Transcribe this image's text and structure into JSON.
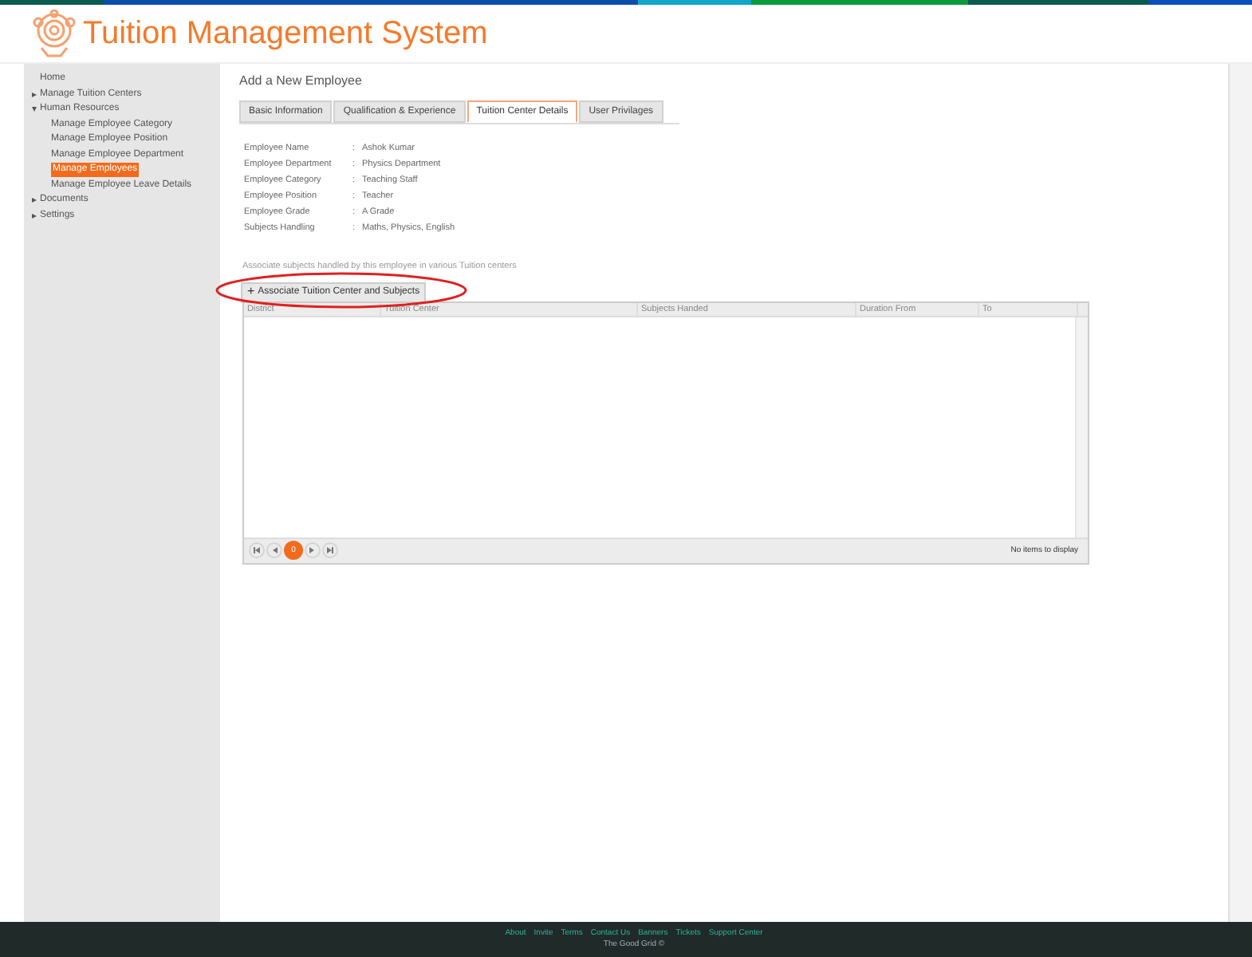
{
  "app_title": "Tuition Management System",
  "sidebar": {
    "items": [
      {
        "label": "Home",
        "selected": false
      },
      {
        "label": "Manage Tuition Centers",
        "expanded": false,
        "selected": false
      },
      {
        "label": "Human Resources",
        "expanded": true,
        "selected": false,
        "children": [
          {
            "label": "Manage Employee Category",
            "selected": false
          },
          {
            "label": "Manage Employee Position",
            "selected": false
          },
          {
            "label": "Manage Employee Department",
            "selected": false
          },
          {
            "label": "Manage Employees",
            "selected": true
          },
          {
            "label": "Manage Employee Leave Details",
            "selected": false
          }
        ]
      },
      {
        "label": "Documents",
        "expanded": false,
        "selected": false
      },
      {
        "label": "Settings",
        "expanded": false,
        "selected": false
      }
    ]
  },
  "page_title": "Add a New Employee",
  "tabs": [
    {
      "label": "Basic Information",
      "selected": false
    },
    {
      "label": "Qualification & Experience",
      "selected": false
    },
    {
      "label": "Tuition Center Details",
      "selected": true
    },
    {
      "label": "User Privilages",
      "selected": false
    }
  ],
  "details": [
    {
      "label": "Employee Name",
      "value": "Ashok Kumar"
    },
    {
      "label": "Employee Department",
      "value": "Physics Department"
    },
    {
      "label": "Employee Category",
      "value": "Teaching Staff"
    },
    {
      "label": "Employee Position",
      "value": "Teacher"
    },
    {
      "label": "Employee Grade",
      "value": "A Grade"
    },
    {
      "label": "Subjects Handling",
      "value": "Maths, Physics, English"
    }
  ],
  "separator": ":",
  "hint": "Associate subjects handled by this employee in various Tuition centers",
  "add_button": {
    "icon": "+",
    "label": "Associate Tuition Center and Subjects",
    "highlighted": true
  },
  "table": {
    "columns": [
      "District",
      "Tuition Center",
      "Subjects Handed",
      "Duration From",
      "To"
    ]
  },
  "pager": {
    "pages": [
      {
        "label": "0",
        "selected": true
      }
    ],
    "status": "No items to display"
  },
  "footer": {
    "links": [
      "About",
      "Invite",
      "Terms",
      "Contact Us",
      "Banners",
      "Tickets",
      "Support Center"
    ],
    "credit": "The Good Grid ©"
  }
}
